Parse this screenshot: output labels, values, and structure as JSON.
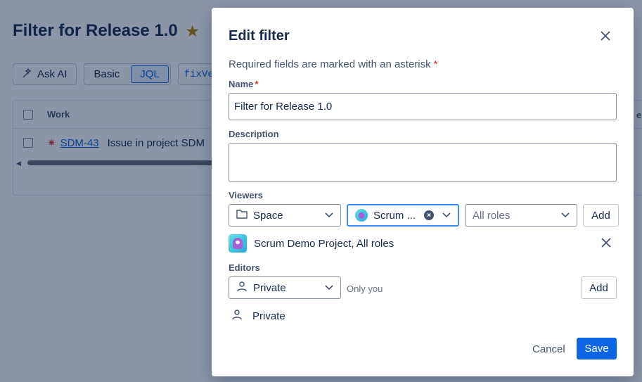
{
  "background": {
    "page_title": "Filter for Release 1.0",
    "ask_ai_label": "Ask AI",
    "mode_basic": "Basic",
    "mode_jql": "JQL",
    "jql_text": "fixVer",
    "table_header_work": "Work",
    "right_header_fragment": "eld",
    "row": {
      "key": "SDM-43",
      "summary": "Issue in project SDM"
    }
  },
  "modal": {
    "title": "Edit filter",
    "required_note": "Required fields are marked with an asterisk",
    "required_mark": "*",
    "name_label": "Name",
    "name_value": "Filter for Release 1.0",
    "description_label": "Description",
    "description_value": "",
    "viewers_label": "Viewers",
    "viewer_type": "Space",
    "viewer_space": "Scrum ...",
    "viewer_roles_placeholder": "All roles",
    "add_label": "Add",
    "viewer_entry": "Scrum Demo Project, All roles",
    "editors_label": "Editors",
    "editor_type": "Private",
    "editor_hint": "Only you",
    "editor_entry": "Private",
    "cancel_label": "Cancel",
    "save_label": "Save"
  },
  "colors": {
    "primary": "#0c66e4",
    "overlay": "rgba(9, 30, 66, 0.47)",
    "required": "#c9372c"
  }
}
